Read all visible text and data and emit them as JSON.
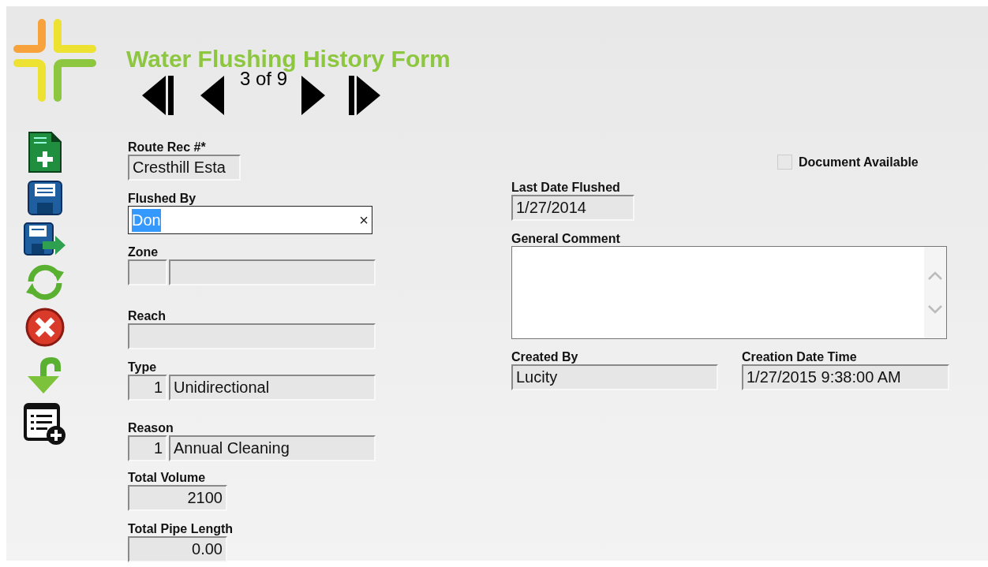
{
  "title": "Water Flushing History Form",
  "navigator": {
    "position": "3 of 9"
  },
  "left_fields": [
    {
      "label": "Route Rec #*",
      "kind": "text",
      "value": "Cresthill Esta"
    },
    {
      "label": "Flushed By",
      "kind": "editable",
      "value": "Don",
      "text_selected": true,
      "clear": "×"
    },
    {
      "label": "Zone",
      "kind": "coded"
    },
    {
      "label": "Reach",
      "kind": "text"
    },
    {
      "label": "Type",
      "kind": "coded",
      "code": "1",
      "value": "Unidirectional"
    },
    {
      "label": "Reason",
      "kind": "coded",
      "code": "1",
      "value": "Annual Cleaning"
    },
    {
      "label": "Total Volume",
      "kind": "number",
      "value": "2100"
    },
    {
      "label": "Total Pipe Length",
      "kind": "number",
      "value": "0.00"
    }
  ],
  "document_available": {
    "label": "Document Available",
    "checked": false
  },
  "last_date_flushed": {
    "label": "Last Date Flushed",
    "value": "1/27/2014"
  },
  "general_comment": {
    "label": "General Comment"
  },
  "created_by": {
    "label": "Created By",
    "value": "Lucity"
  },
  "creation_date_time": {
    "label": "Creation Date Time",
    "value": "1/27/2015 9:38:00 AM"
  }
}
